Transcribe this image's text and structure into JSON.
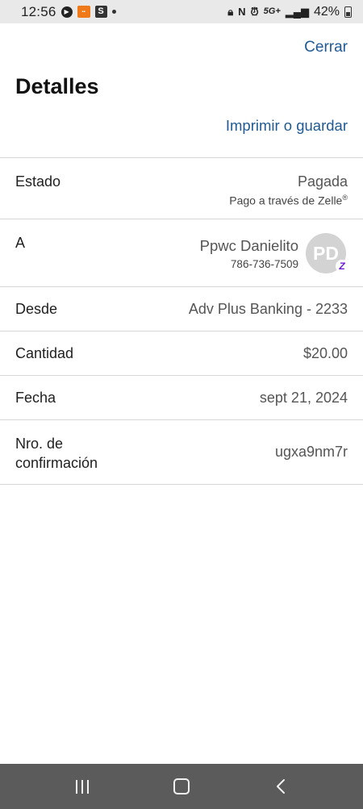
{
  "status_bar": {
    "time": "12:56",
    "battery": "42%",
    "network": "5G+"
  },
  "header": {
    "close_label": "Cerrar",
    "title": "Detalles",
    "print_label": "Imprimir o guardar"
  },
  "details": {
    "estado": {
      "label": "Estado",
      "value": "Pagada",
      "sub": "Pago a través de Zelle",
      "sub_mark": "®"
    },
    "a": {
      "label": "A",
      "name": "Ppwc Danielito",
      "phone": "786-736-7509",
      "avatar_initials": "PD",
      "badge": "Z"
    },
    "desde": {
      "label": "Desde",
      "value": "Adv Plus Banking - 2233"
    },
    "cantidad": {
      "label": "Cantidad",
      "value": "$20.00"
    },
    "fecha": {
      "label": "Fecha",
      "value": "sept 21, 2024"
    },
    "confirmacion": {
      "label_line1": "Nro. de",
      "label_line2": "confirmación",
      "value": "ugxa9nm7r"
    }
  },
  "nav_bar": {
    "icons": [
      "recents-icon",
      "home-icon",
      "back-icon"
    ]
  }
}
